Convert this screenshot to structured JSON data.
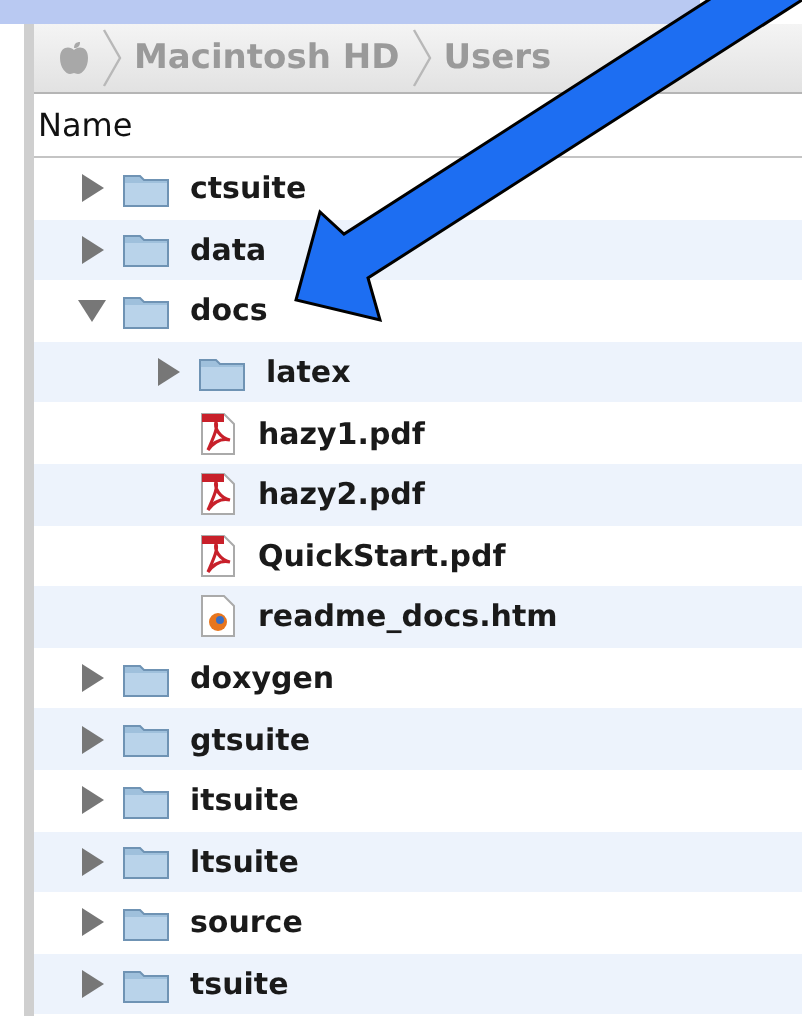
{
  "path_bar": {
    "segments": [
      "Macintosh HD",
      "Users"
    ]
  },
  "column_header": "Name",
  "tree": [
    {
      "name": "ctsuite",
      "kind": "folder",
      "expanded": false
    },
    {
      "name": "data",
      "kind": "folder",
      "expanded": false
    },
    {
      "name": "docs",
      "kind": "folder",
      "expanded": true,
      "children": [
        {
          "name": "latex",
          "kind": "folder",
          "expanded": false
        },
        {
          "name": "hazy1.pdf",
          "kind": "pdf"
        },
        {
          "name": "hazy2.pdf",
          "kind": "pdf"
        },
        {
          "name": "QuickStart.pdf",
          "kind": "pdf"
        },
        {
          "name": "readme_docs.htm",
          "kind": "htm"
        }
      ]
    },
    {
      "name": "doxygen",
      "kind": "folder",
      "expanded": false
    },
    {
      "name": "gtsuite",
      "kind": "folder",
      "expanded": false
    },
    {
      "name": "itsuite",
      "kind": "folder",
      "expanded": false
    },
    {
      "name": "ltsuite",
      "kind": "folder",
      "expanded": false
    },
    {
      "name": "source",
      "kind": "folder",
      "expanded": false
    },
    {
      "name": "tsuite",
      "kind": "folder",
      "expanded": false
    }
  ]
}
